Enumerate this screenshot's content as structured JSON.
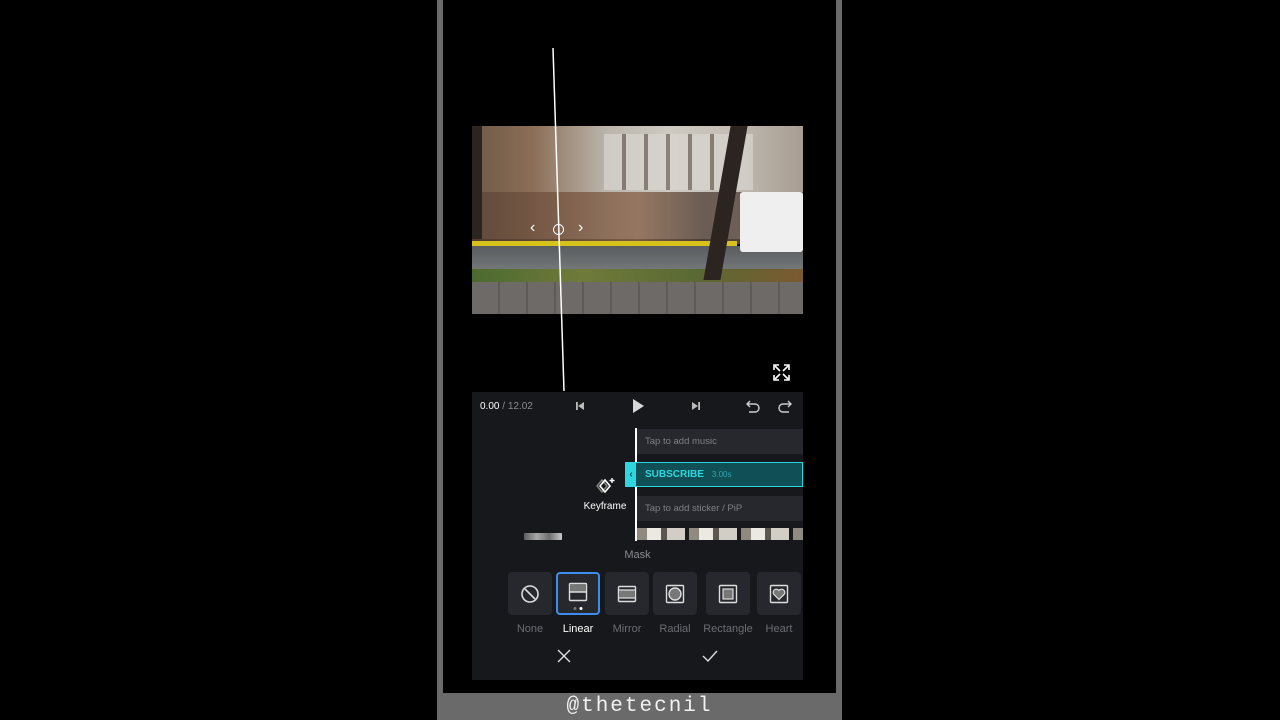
{
  "watermark": "@thetecnil",
  "player": {
    "current_time": "0.00",
    "separator": " / ",
    "total_time": "12.02",
    "controls": [
      "skip-back-icon",
      "play-icon",
      "skip-forward-icon",
      "undo-icon",
      "redo-icon"
    ]
  },
  "timeline": {
    "music_placeholder": "Tap to add music",
    "text_clip": {
      "label": "SUBSCRIBE",
      "duration": "3.00s"
    },
    "sticker_placeholder": "Tap to add sticker / PiP",
    "keyframe_label": "Keyframe"
  },
  "mask": {
    "title": "Mask",
    "options": [
      {
        "label": "None",
        "icon": "none-icon",
        "selected": false
      },
      {
        "label": "Linear",
        "icon": "linear-mask-icon",
        "selected": true
      },
      {
        "label": "Mirror",
        "icon": "mirror-mask-icon",
        "selected": false
      },
      {
        "label": "Radial",
        "icon": "radial-mask-icon",
        "selected": false
      },
      {
        "label": "Rectangle",
        "icon": "rectangle-mask-icon",
        "selected": false
      },
      {
        "label": "Heart",
        "icon": "heart-mask-icon",
        "selected": false
      }
    ]
  },
  "actions": {
    "cancel": "close-icon",
    "confirm": "check-icon"
  },
  "colors": {
    "accent_cyan": "#2ed7e0",
    "selected_blue": "#3d8cf0",
    "panel_bg": "#17181c"
  }
}
